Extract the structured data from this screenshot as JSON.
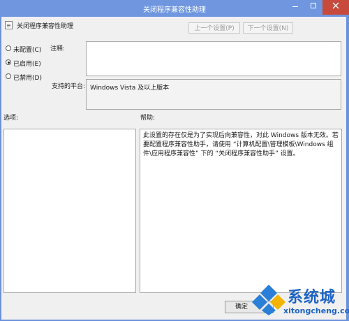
{
  "window": {
    "title": "关闭程序兼容性助理"
  },
  "header": {
    "policy_name": "关闭程序兼容性助理",
    "prev_label": "上一个设置(P)",
    "next_label": "下一个设置(N)"
  },
  "state": {
    "options": [
      {
        "label": "未配置(C)",
        "checked": false
      },
      {
        "label": "已启用(E)",
        "checked": true
      },
      {
        "label": "已禁用(D)",
        "checked": false
      }
    ]
  },
  "comment": {
    "label": "注释:",
    "value": ""
  },
  "platform": {
    "label": "支持的平台:",
    "value": "Windows Vista 及以上版本"
  },
  "options_panel": {
    "label": "选项:"
  },
  "help_panel": {
    "label": "帮助:",
    "text": "此设置的存在仅是为了实现后向兼容性，对此 Windows 版本无效。若要配置程序兼容性助手，请使用 “计算机配置\\管理模板\\Windows 组件\\应用程序兼容性” 下的 “关闭程序兼容性助手” 设置。"
  },
  "footer": {
    "ok_label": "确定"
  },
  "watermark": {
    "brand": "系统城",
    "domain": "xitongcheng.com"
  },
  "colors": {
    "titlebar": "#6f96df",
    "close": "#c74a3d",
    "client": "#f0f0f0",
    "watermark": "#1d63c4"
  }
}
